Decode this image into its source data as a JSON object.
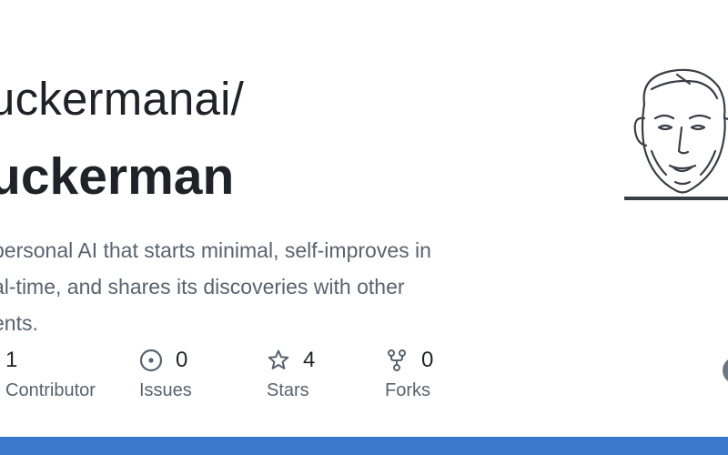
{
  "repo": {
    "owner_line": "uckermanai/",
    "name": "uckerman",
    "description_lines": [
      "personal AI that starts minimal, self-improves in",
      "al-time, and shares its discoveries with other",
      "ents."
    ]
  },
  "stats": [
    {
      "key": "contributors",
      "value": "1",
      "label": "Contributor",
      "icon": "people-icon"
    },
    {
      "key": "issues",
      "value": "0",
      "label": "Issues",
      "icon": "issue-circle-icon"
    },
    {
      "key": "stars",
      "value": "4",
      "label": "Stars",
      "icon": "star-icon"
    },
    {
      "key": "forks",
      "value": "0",
      "label": "Forks",
      "icon": "fork-icon"
    }
  ],
  "colors": {
    "text_primary": "#1f2328",
    "text_secondary": "#59636e",
    "bottom_bar": "#3a79cc"
  }
}
